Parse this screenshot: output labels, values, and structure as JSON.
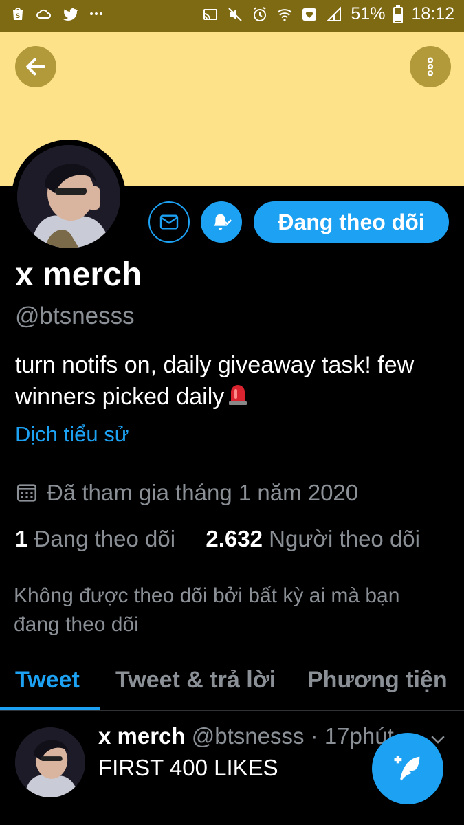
{
  "status_bar": {
    "battery": "51%",
    "time": "18:12",
    "left_icons": [
      "shop-icon",
      "cloud-icon",
      "twitter-icon",
      "more-dots-icon"
    ],
    "right_icons": [
      "cast-icon",
      "mute-icon",
      "alarm-icon",
      "wifi-icon",
      "heart-icon",
      "signal-icon",
      "battery-icon"
    ]
  },
  "banner": {
    "color": "#fde28a",
    "button_color": "#b29a3a"
  },
  "profile": {
    "name": "x merch",
    "handle": "@btsnesss",
    "bio": "turn notifs on, daily giveaway task! few winners picked daily",
    "translate_label": "Dịch tiểu sử",
    "joined": "Đã tham gia tháng 1 năm 2020",
    "following_count": "1",
    "following_label": "Đang theo dõi",
    "followers_count": "2.632",
    "followers_label": "Người theo dõi",
    "not_followed_note": "Không được theo dõi bởi bất kỳ ai mà bạn đang theo dõi"
  },
  "actions": {
    "follow_label": "Đang theo dõi",
    "accent": "#1da1f2"
  },
  "tabs": [
    {
      "label": "Tweet",
      "active": true
    },
    {
      "label": "Tweet & trả lời",
      "active": false
    },
    {
      "label": "Phương tiện",
      "active": false
    }
  ],
  "tweet": {
    "name": "x merch",
    "handle": "@btsnesss",
    "separator": "·",
    "time": "17phút",
    "text": "FIRST 400 LIKES"
  }
}
